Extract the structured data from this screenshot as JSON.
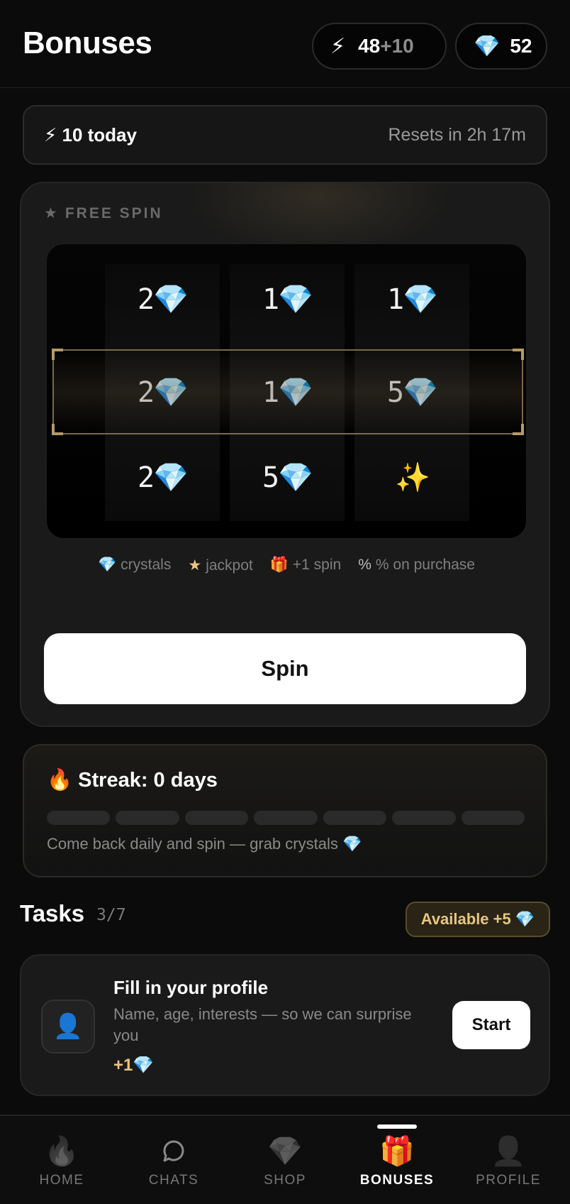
{
  "header": {
    "title": "Bonuses",
    "energy": {
      "icon": "lightning-icon",
      "value": "48",
      "bonus": "+10"
    },
    "gems": {
      "icon": "gem-icon",
      "value": "52"
    }
  },
  "today": {
    "label": "⚡ 10 today",
    "reset": "Resets in 2h 17m"
  },
  "free_spin": {
    "label": "FREE SPIN",
    "reels": [
      [
        "2💎",
        "2💎",
        "2💎"
      ],
      [
        "1💎",
        "1💎",
        "5💎"
      ],
      [
        "1💎",
        "5💎",
        "✨"
      ]
    ],
    "legend": [
      {
        "icon": "💎",
        "text": "crystals"
      },
      {
        "icon": "★",
        "text": "jackpot"
      },
      {
        "icon": "🎁",
        "text": "+1 spin"
      },
      {
        "icon": "%",
        "text": "% on purchase"
      }
    ],
    "button": "Spin"
  },
  "streak": {
    "title": "🔥 Streak: 0 days",
    "days_total": 7,
    "days_done": 0,
    "text": "Come back daily and spin — grab crystals 💎"
  },
  "tasks": {
    "title": "Tasks",
    "count": "3/7",
    "available": "Available +5 💎",
    "items": [
      {
        "icon": "👤",
        "title": "Fill in your profile",
        "desc": "Name, age, interests — so we can surprise you",
        "reward": "+1💎",
        "button": "Start"
      }
    ]
  },
  "nav": {
    "items": [
      {
        "icon": "🔥",
        "label": "HOME"
      },
      {
        "icon": "chat",
        "label": "CHATS"
      },
      {
        "icon": "💎",
        "label": "SHOP"
      },
      {
        "icon": "🎁",
        "label": "BONUSES",
        "active": true
      },
      {
        "icon": "👤",
        "label": "PROFILE"
      }
    ]
  },
  "colors": {
    "accent_gold": "#e8c680",
    "background": "#0b0b0b",
    "card": "#1a1a1a"
  }
}
